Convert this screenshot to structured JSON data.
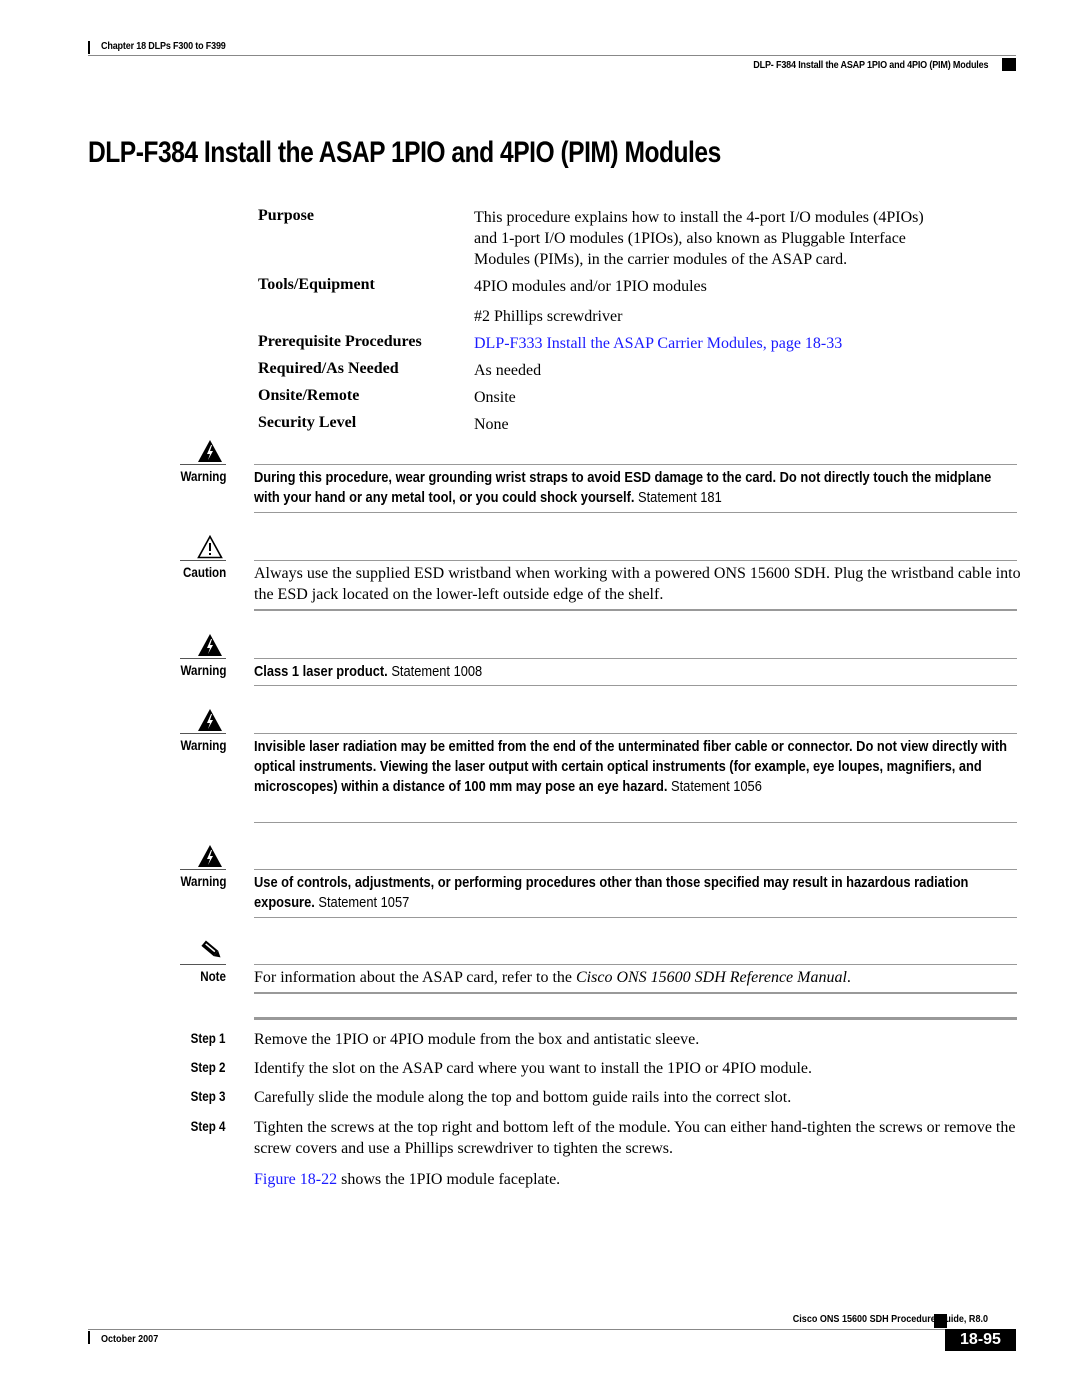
{
  "header": {
    "chapter": "Chapter 18 DLPs F300 to F399",
    "section": "DLP- F384 Install the ASAP 1PIO and 4PIO (PIM) Modules"
  },
  "title": "DLP-F384 Install the ASAP 1PIO and 4PIO (PIM) Modules",
  "info_table": {
    "purpose_label": "Purpose",
    "purpose_lines": [
      "This procedure explains how to install the 4-port I/O modules (4PIOs)",
      "and 1-port I/O modules (1PIOs), also known as Pluggable Interface",
      "Modules (PIMs), in the carrier modules of the ASAP card."
    ],
    "tools_label": "Tools/Equipment",
    "tools_values": [
      "4PIO modules and/or 1PIO modules",
      "#2 Phillips screwdriver"
    ],
    "prereq_label": "Prerequisite Procedures",
    "prereq_link": "DLP-F333 Install the ASAP Carrier Modules, page 18-33",
    "required_label": "Required/As Needed",
    "required_value": "As needed",
    "onsite_label": "Onsite/Remote",
    "onsite_value": "Onsite",
    "security_label": "Security Level",
    "security_value": "None"
  },
  "admonitions": [
    {
      "type": "Warning",
      "icon": "warning-triangle-bolt-icon",
      "bold_text": "During this procedure, wear grounding wrist straps to avoid ESD damage to the card. Do not directly touch the midplane with your hand or any metal tool, or you could shock yourself.",
      "statement": " Statement 181"
    },
    {
      "type": "Caution",
      "icon": "caution-triangle-icon",
      "text": "Always use the supplied ESD wristband when working with a powered ONS 15600 SDH. Plug the wristband cable into the ESD jack located on the lower-left outside edge of the shelf."
    },
    {
      "type": "Warning",
      "icon": "warning-triangle-bolt-icon",
      "bold_text": "Class 1 laser product.",
      "statement": " Statement 1008"
    },
    {
      "type": "Warning",
      "icon": "warning-triangle-bolt-icon",
      "bold_text": "Invisible laser radiation may be emitted from the end of the unterminated fiber cable or connector. Do not view directly with optical instruments. Viewing the laser output with certain optical instruments (for example, eye loupes, magnifiers, and microscopes) within a distance of 100 mm may pose an eye hazard.",
      "statement": " Statement 1056"
    },
    {
      "type": "Warning",
      "icon": "warning-triangle-bolt-icon",
      "bold_text": "Use of controls, adjustments, or performing procedures other than those specified may result in hazardous radiation exposure.",
      "statement": " Statement 1057"
    },
    {
      "type": "Note",
      "icon": "pencil-note-icon",
      "text_before": "For information about the ASAP card, refer to the ",
      "text_italic": "Cisco ONS 15600 SDH Reference Manual",
      "text_after": "."
    }
  ],
  "steps": [
    {
      "label": "Step 1",
      "text": "Remove the 1PIO or 4PIO module from the box and antistatic sleeve."
    },
    {
      "label": "Step 2",
      "text": "Identify the slot on the ASAP card where you want to install the 1PIO or 4PIO module."
    },
    {
      "label": "Step 3",
      "text": "Carefully slide the module along the top and bottom guide rails into the correct slot."
    },
    {
      "label": "Step 4",
      "text": "Tighten the screws at the top right and bottom left of the module. You can either hand-tighten the screws or remove the screw covers and use a Phillips screwdriver to tighten the screws."
    }
  ],
  "figure_ref": {
    "link": "Figure 18-22",
    "text": " shows the 1PIO module faceplate."
  },
  "footer": {
    "guide_title": "Cisco ONS 15600 SDH Procedure Guide, R8.0",
    "date": "October 2007",
    "page_number": "18-95"
  },
  "colors": {
    "link": "#1a1aff",
    "rule": "#999999"
  }
}
